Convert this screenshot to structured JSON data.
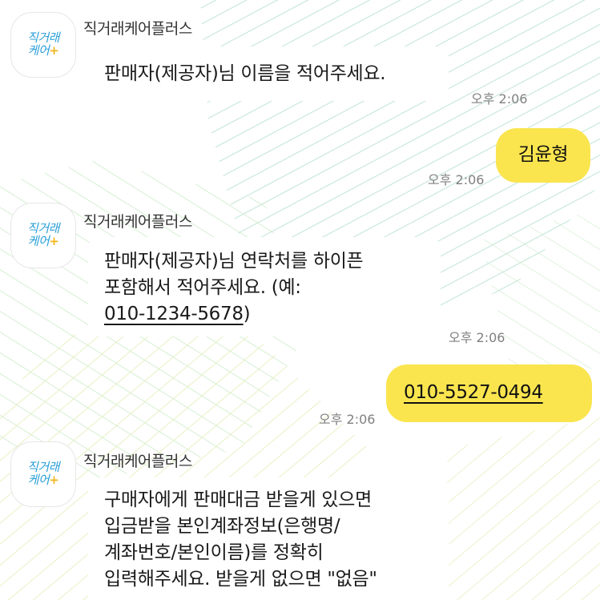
{
  "chat": {
    "sender_name": "직거래케어플러스",
    "avatar": {
      "line1": "직거래",
      "line2": "케어",
      "plus": "+"
    },
    "messages": [
      {
        "type": "incoming",
        "text": "판매자(제공자)님 이름을 적어주세요.",
        "time": "오후 2:06"
      },
      {
        "type": "outgoing",
        "text": "김윤형",
        "time": "오후 2:06"
      },
      {
        "type": "incoming",
        "line1": "판매자(제공자)님 연락처를 하이픈",
        "line2": "포함해서 적어주세요. (예:",
        "line3_link": "010-1234-5678",
        "line3_end": ")",
        "time": "오후 2:06"
      },
      {
        "type": "outgoing",
        "link": "010-5527-0494",
        "time": "오후 2:06"
      },
      {
        "type": "incoming",
        "line1": "구매자에게 판매대금 받을게 있으면",
        "line2": "입금받을 본인계좌정보(은행명/",
        "line3": "계좌번호/본인이름)를 정확히",
        "line4": "입력해주세요.  받을게 없으면 \"없음\""
      }
    ]
  },
  "colors": {
    "outgoing_bubble": "#fae54f",
    "incoming_bubble": "#ffffff",
    "avatar_text": "#2a9fd8",
    "avatar_plus": "#f2b51c",
    "background_pattern": "#bfe3d4"
  }
}
